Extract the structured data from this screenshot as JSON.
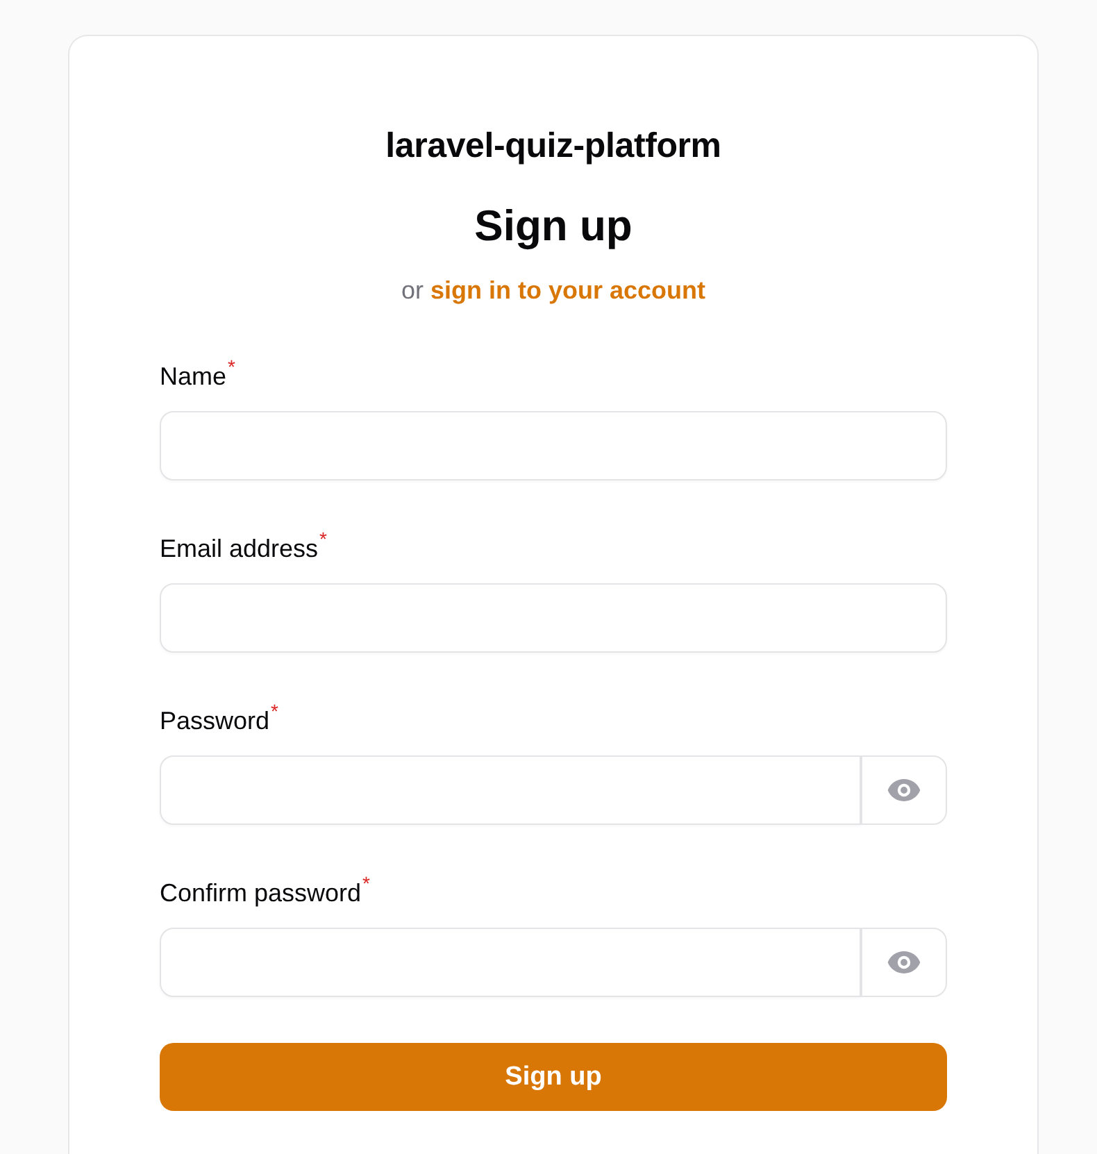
{
  "app_title": "laravel-quiz-platform",
  "heading": "Sign up",
  "subtitle": {
    "prefix": "or",
    "link": "sign in to your account"
  },
  "fields": [
    {
      "label": "Name",
      "required_mark": "*",
      "kind": "text"
    },
    {
      "label": "Email address",
      "required_mark": "*",
      "kind": "email"
    },
    {
      "label": "Password",
      "required_mark": "*",
      "kind": "password"
    },
    {
      "label": "Confirm password",
      "required_mark": "*",
      "kind": "password"
    }
  ],
  "submit_button": "Sign up"
}
